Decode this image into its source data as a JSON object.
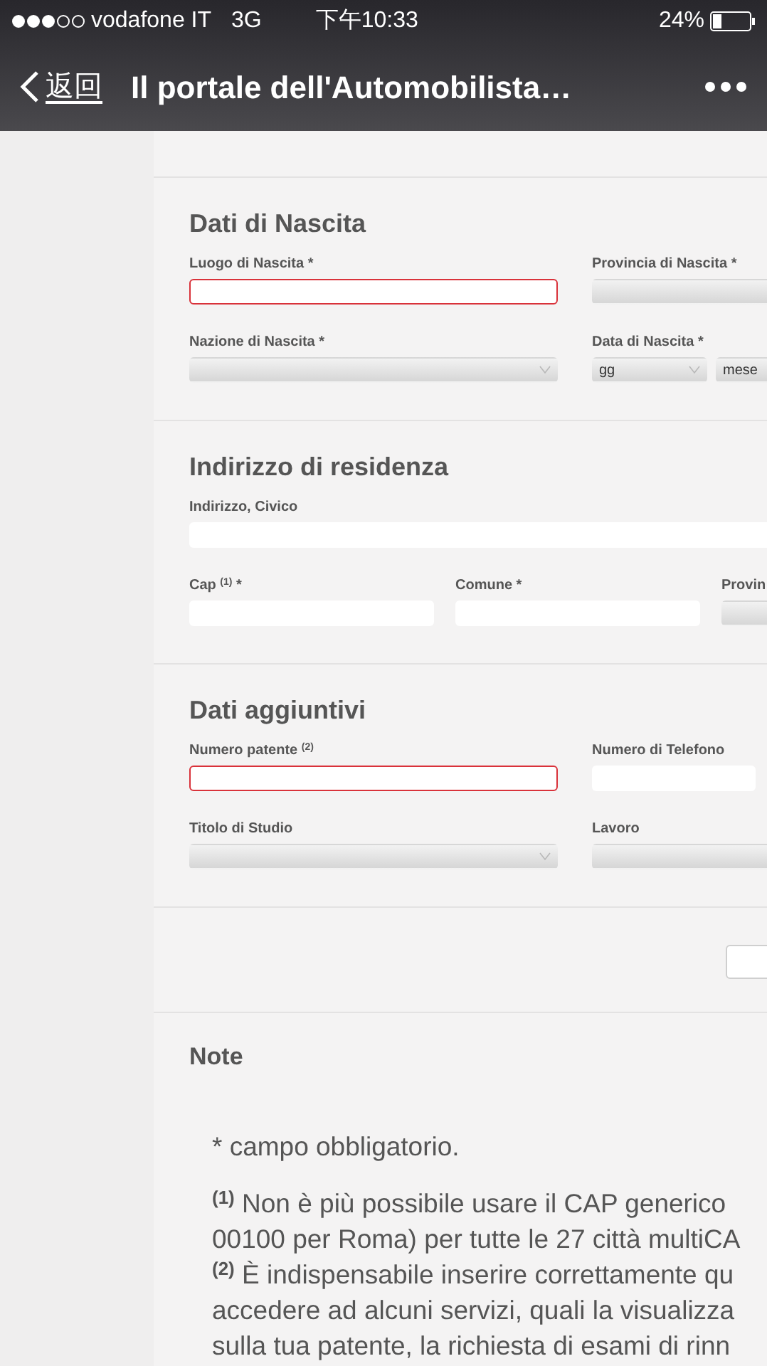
{
  "status_bar": {
    "carrier": "vodafone IT",
    "network": "3G",
    "time": "下午10:33",
    "battery": "24%"
  },
  "nav_bar": {
    "back": "返回",
    "title": "Il portale dell'Automobilista…"
  },
  "sections": [
    {
      "title": "Dati di Nascita",
      "rows": [
        [
          {
            "label": "Luogo di Nascita *",
            "kind": "input",
            "invalid": true
          },
          {
            "label": "Provincia di Nascita *",
            "kind": "select_cut",
            "invalid": false
          }
        ],
        [
          {
            "label": "Nazione di Nascita *",
            "kind": "select",
            "invalid": false
          },
          {
            "label": "Data di Nascita *",
            "kind": "date",
            "invalid": false,
            "day": "gg",
            "month": "mese"
          }
        ]
      ]
    },
    {
      "title": "Indirizzo di residenza",
      "rows": [
        [
          {
            "label": "Indirizzo, Civico",
            "kind": "input",
            "invalid": false,
            "wide": true
          }
        ],
        [
          {
            "label": "Cap $^{(1)}$ *",
            "kind": "input",
            "invalid": false
          },
          {
            "label": "Comune *",
            "kind": "input",
            "invalid": false
          },
          {
            "label": "Provin",
            "kind": "select_cut",
            "invalid": false
          }
        ]
      ]
    },
    {
      "title": "Dati aggiuntivi",
      "rows": [
        [
          {
            "label": "Numero patente $^{(2)}$",
            "kind": "input",
            "invalid": true
          },
          {
            "label": "Numero di Telefono",
            "kind": "input",
            "invalid": false,
            "short": true
          }
        ],
        [
          {
            "label": "Titolo di Studio",
            "kind": "select",
            "invalid": false
          },
          {
            "label": "Lavoro",
            "kind": "select_cut",
            "invalid": false
          }
        ]
      ]
    }
  ],
  "notes": {
    "title": "Note",
    "required": "* campo obbligatorio.",
    "lines": [
      "$^{(1)}$ Non è più possibile usare il CAP generico",
      "00100 per Roma) per tutte le 27 città multiCA",
      "$^{(2)}$ È indispensabile inserire correttamente qu",
      "accedere ad alcuni servizi, quali la visualizza",
      "sulla tua patente, la richiesta di esami di rinn"
    ]
  }
}
